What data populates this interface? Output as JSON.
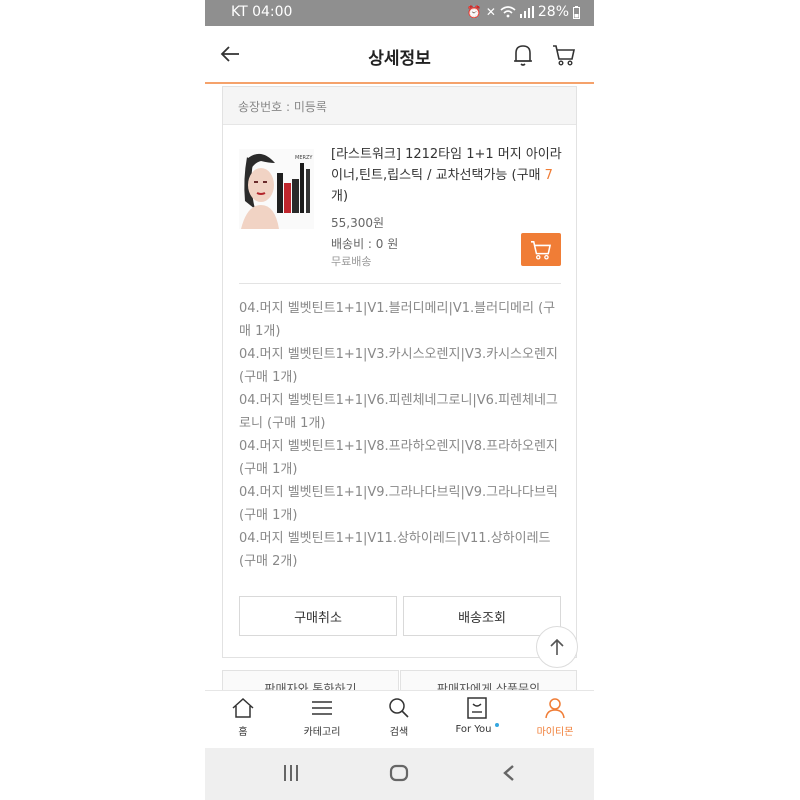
{
  "status_bar": {
    "carrier": "KT",
    "time": "04:00",
    "icons": [
      "alarm-icon",
      "mute-icon",
      "wifi-icon",
      "signal-icon"
    ],
    "battery": "28%"
  },
  "header": {
    "title": "상세정보",
    "icons": [
      "back-arrow-icon",
      "bell-icon",
      "cart-icon"
    ]
  },
  "order": {
    "invoice": "송장번호 : 미등록",
    "product": {
      "name": "[라스트워크] 1212타임 1+1 머지 아이라이너,틴트,립스틱 / 교차선택가능 (구매 ",
      "qty": "7",
      "name_end": "개)",
      "price": "55,300원",
      "shipping_fee": "배송비 : 0 원",
      "shipping_type": "무료배송"
    },
    "options": [
      "04.머지 벨벳틴트1+1|V1.블러디메리|V1.블러디메리 (구매 1개)",
      "04.머지 벨벳틴트1+1|V3.카시스오렌지|V3.카시스오렌지 (구매 1개)",
      "04.머지 벨벳틴트1+1|V6.피렌체네그로니|V6.피렌체네그로니 (구매 1개)",
      "04.머지 벨벳틴트1+1|V8.프라하오렌지|V8.프라하오렌지 (구매 1개)",
      "04.머지 벨벳틴트1+1|V9.그라나다브릭|V9.그라나다브릭 (구매 1개)",
      "04.머지 벨벳틴트1+1|V11.상하이레드|V11.상하이레드 (구매 2개)"
    ],
    "buttons": {
      "cancel": "구매취소",
      "track": "배송조회"
    },
    "seller_buttons": {
      "call": "판매자와 통화하기",
      "ask": "판매자에게 상품문의"
    }
  },
  "bottom_nav": [
    {
      "label": "홈",
      "icon": "home-icon"
    },
    {
      "label": "카테고리",
      "icon": "menu-icon"
    },
    {
      "label": "검색",
      "icon": "search-icon"
    },
    {
      "label": "For You",
      "icon": "for-you-icon"
    },
    {
      "label": "마이티몬",
      "icon": "person-icon"
    }
  ],
  "colors": {
    "accent": "#f07d36",
    "status_bar": "#8f8f8f",
    "header_border": "#f5a26b"
  }
}
